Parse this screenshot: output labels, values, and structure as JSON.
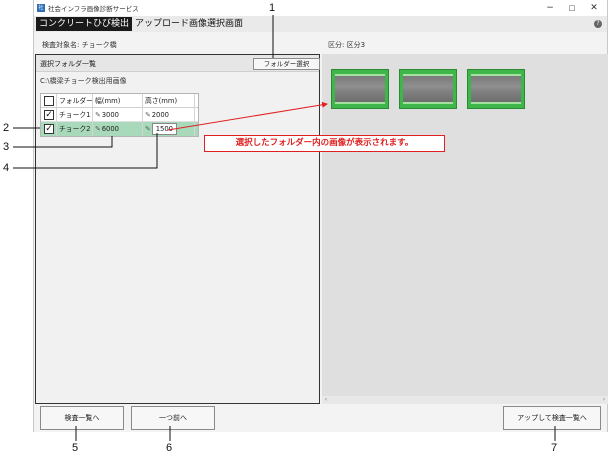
{
  "window": {
    "title": "社会インフラ画像診断サービス",
    "icon_name": "app-icon",
    "controls": {
      "minimize": "−",
      "maximize": "□",
      "close": "✕"
    }
  },
  "header": {
    "active_tab": "コンクリートひび検出",
    "screen_title": "アップロード画像選択画面",
    "help_icon": "?"
  },
  "info": {
    "target": "検査対象名:  チョーク橋",
    "class": "区分:  区分3"
  },
  "folder_panel": {
    "title": "選択フォルダ一覧",
    "select_button": "フォルダー選択",
    "path": "C:\\橋梁チョーク検出用画像",
    "columns": [
      "",
      "フォルダー",
      "幅(mm)",
      "高さ(mm)"
    ],
    "rows": [
      {
        "checked": true,
        "folder": "チョーク1",
        "width": "3000",
        "height": "2000",
        "selected": false
      },
      {
        "checked": true,
        "folder": "チョーク2",
        "width": "6000",
        "height": "1500",
        "selected": true
      }
    ]
  },
  "preview": {
    "thumbnail_count": 3
  },
  "footer": {
    "back_to_list": "検査一覧へ",
    "previous": "一つ前へ",
    "upload": "アップして検査一覧へ"
  },
  "annotation": {
    "callout": "選択したフォルダー内の画像が表示されます。",
    "callout_color": "#e02020",
    "numbers": [
      "1",
      "2",
      "3",
      "4",
      "5",
      "6",
      "7"
    ]
  },
  "colors": {
    "selected_row": "#a9d9bb",
    "thumb_frame": "#3fb64a",
    "tab_bg": "#1a1a1a"
  }
}
